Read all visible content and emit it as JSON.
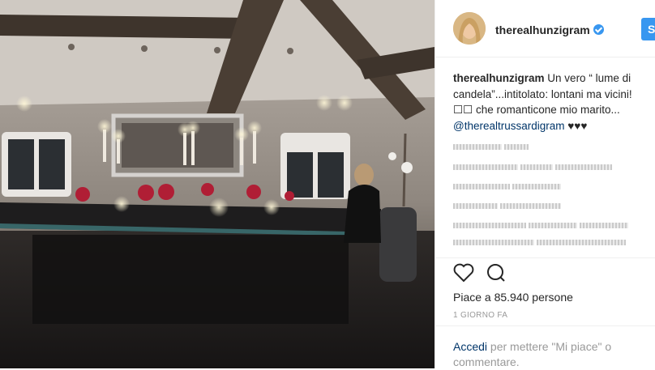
{
  "post": {
    "username": "therealhunzigram",
    "follow_label": "S",
    "caption_user": "therealhunzigram",
    "caption_text": "Un vero “ lume di candela”...intitolato: lontani ma vicini! ☐☐ che romanticone mio marito... ",
    "mention": "@therealtrussardigram",
    "hearts": "♥♥♥",
    "likes": "Piace a 85.940 persone",
    "time": "1 GIORNO FA"
  },
  "login": {
    "link": "Accedi",
    "text": " per mettere \"Mi piace\" o commentare."
  },
  "colors": {
    "accent": "#3897f0",
    "link": "#003569",
    "text": "#262626",
    "muted": "#999999"
  },
  "icons": [
    "verified-badge-icon",
    "heart-icon",
    "comment-icon"
  ]
}
